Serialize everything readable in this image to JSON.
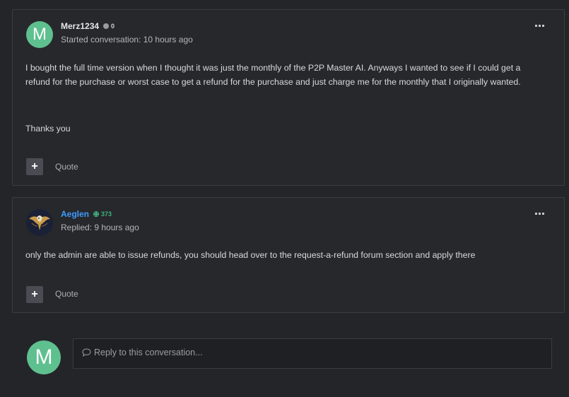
{
  "posts": [
    {
      "avatar_letter": "M",
      "author": "Merz1234",
      "reputation": "0",
      "meta": "Started conversation: 10 hours ago",
      "paragraphs": [
        "I bought the full time version when I thought it was just the monthly of the P2P Master AI. Anyways I wanted to see if I  could get a refund for the purchase or worst case to get a refund for the purchase and just charge me for the monthly that I originally wanted.",
        "Thanks you"
      ],
      "plus_label": "+",
      "quote_label": "Quote"
    },
    {
      "avatar_icon": "eagle-avatar",
      "author": "Aeglen",
      "reputation": "373",
      "meta": "Replied: 9 hours ago",
      "paragraphs": [
        "only the admin are able to issue refunds, you should head over to the request-a-refund forum section and apply there"
      ],
      "plus_label": "+",
      "quote_label": "Quote"
    }
  ],
  "reply": {
    "avatar_letter": "M",
    "placeholder": "Reply to this conversation..."
  },
  "colors": {
    "background": "#242529",
    "card": "#27282c",
    "avatar_green": "#5fc08f",
    "author_blue": "#3d9bff",
    "rep_positive": "#3fb27f"
  }
}
